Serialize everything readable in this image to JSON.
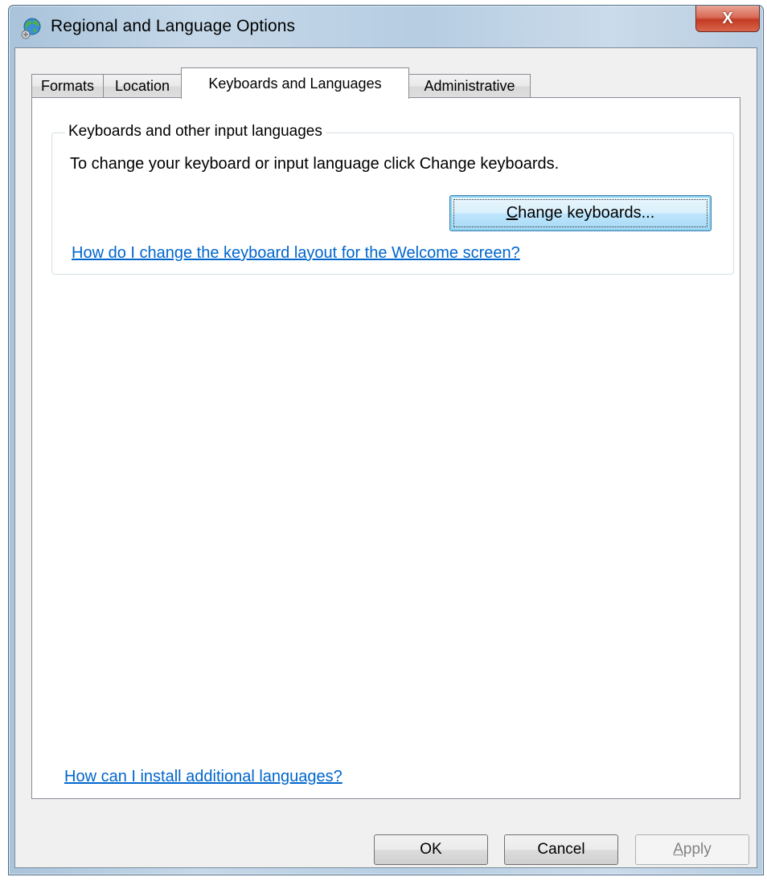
{
  "window": {
    "title": "Regional and Language Options",
    "close_label": "X"
  },
  "tabs": [
    {
      "label": "Formats",
      "active": false
    },
    {
      "label": "Location",
      "active": false
    },
    {
      "label": "Keyboards and Languages",
      "active": true
    },
    {
      "label": "Administrative",
      "active": false
    }
  ],
  "keyboards_group": {
    "legend": "Keyboards and other input languages",
    "description": "To change your keyboard or input language click Change keyboards.",
    "change_button": {
      "mnemonic": "C",
      "rest": "hange keyboards..."
    },
    "welcome_link": "How do I change the keyboard layout for the Welcome screen?"
  },
  "install_link": "How can I install additional languages?",
  "buttons": {
    "ok": "OK",
    "cancel": "Cancel",
    "apply": {
      "mnemonic": "A",
      "rest": "pply"
    }
  },
  "colors": {
    "link": "#0066cc",
    "close_button": "#c33a23"
  }
}
